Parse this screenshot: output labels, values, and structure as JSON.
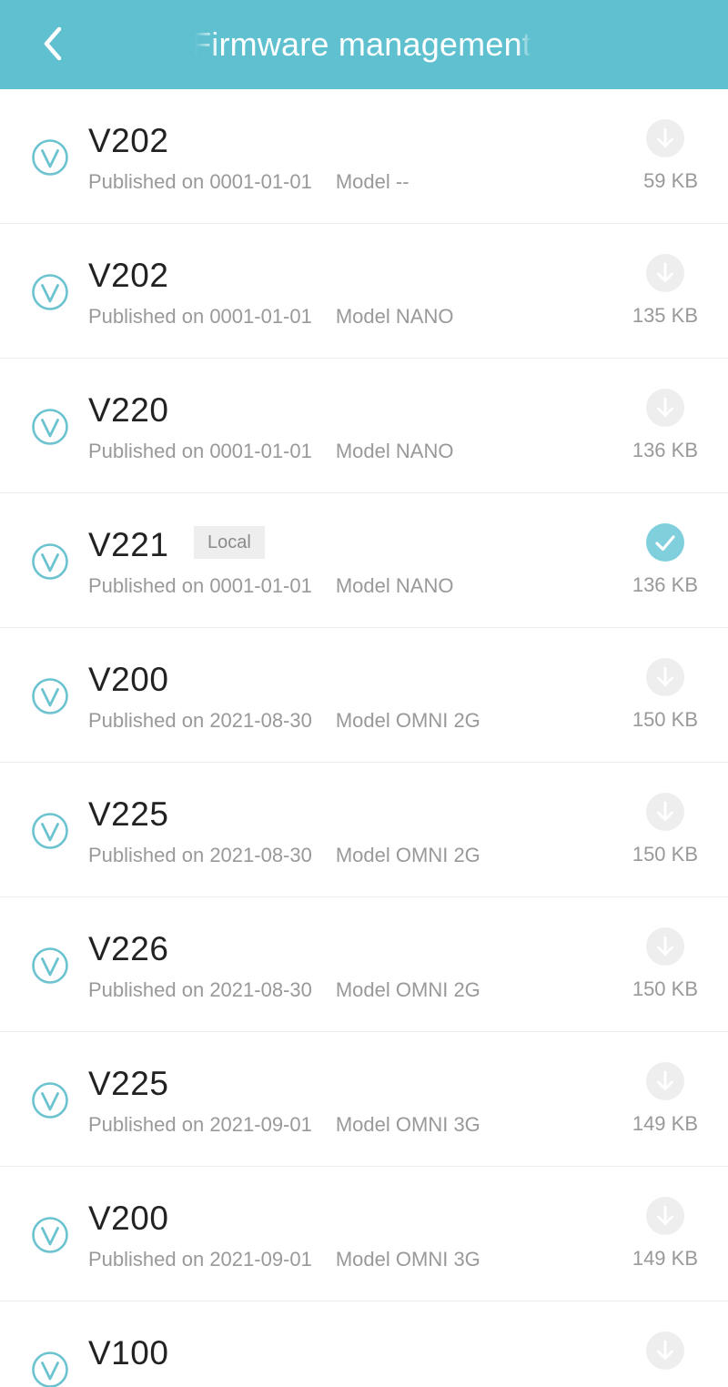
{
  "header": {
    "title": "Firmware management",
    "back_icon": "chevron-left-icon",
    "background": "#5fc0cf"
  },
  "items": [
    {
      "version": "V202",
      "badge": "",
      "published": "Published on 0001-01-01",
      "model": "Model --",
      "size": "59 KB",
      "status": "download"
    },
    {
      "version": "V202",
      "badge": "",
      "published": "Published on 0001-01-01",
      "model": "Model NANO",
      "size": "135 KB",
      "status": "download"
    },
    {
      "version": "V220",
      "badge": "",
      "published": "Published on 0001-01-01",
      "model": "Model NANO",
      "size": "136 KB",
      "status": "download"
    },
    {
      "version": "V221",
      "badge": "Local",
      "published": "Published on 0001-01-01",
      "model": "Model NANO",
      "size": "136 KB",
      "status": "downloaded"
    },
    {
      "version": "V200",
      "badge": "",
      "published": "Published on 2021-08-30",
      "model": "Model OMNI 2G",
      "size": "150 KB",
      "status": "download"
    },
    {
      "version": "V225",
      "badge": "",
      "published": "Published on 2021-08-30",
      "model": "Model OMNI 2G",
      "size": "150 KB",
      "status": "download"
    },
    {
      "version": "V226",
      "badge": "",
      "published": "Published on 2021-08-30",
      "model": "Model OMNI 2G",
      "size": "150 KB",
      "status": "download"
    },
    {
      "version": "V225",
      "badge": "",
      "published": "Published on 2021-09-01",
      "model": "Model OMNI 3G",
      "size": "149 KB",
      "status": "download"
    },
    {
      "version": "V200",
      "badge": "",
      "published": "Published on 2021-09-01",
      "model": "Model OMNI 3G",
      "size": "149 KB",
      "status": "download"
    },
    {
      "version": "V100",
      "badge": "",
      "published": "",
      "model": "",
      "size": "",
      "status": "download"
    }
  ],
  "colors": {
    "accent": "#5fc0cf",
    "icon_teal": "#6cc3d0",
    "download_disabled": "#eeeeee",
    "downloaded_check": "#7fd0dc",
    "primary_text": "#222222",
    "secondary_text": "#999999"
  },
  "icons": {
    "version": "v-firmware-icon",
    "download": "download-icon",
    "downloaded": "check-icon"
  }
}
